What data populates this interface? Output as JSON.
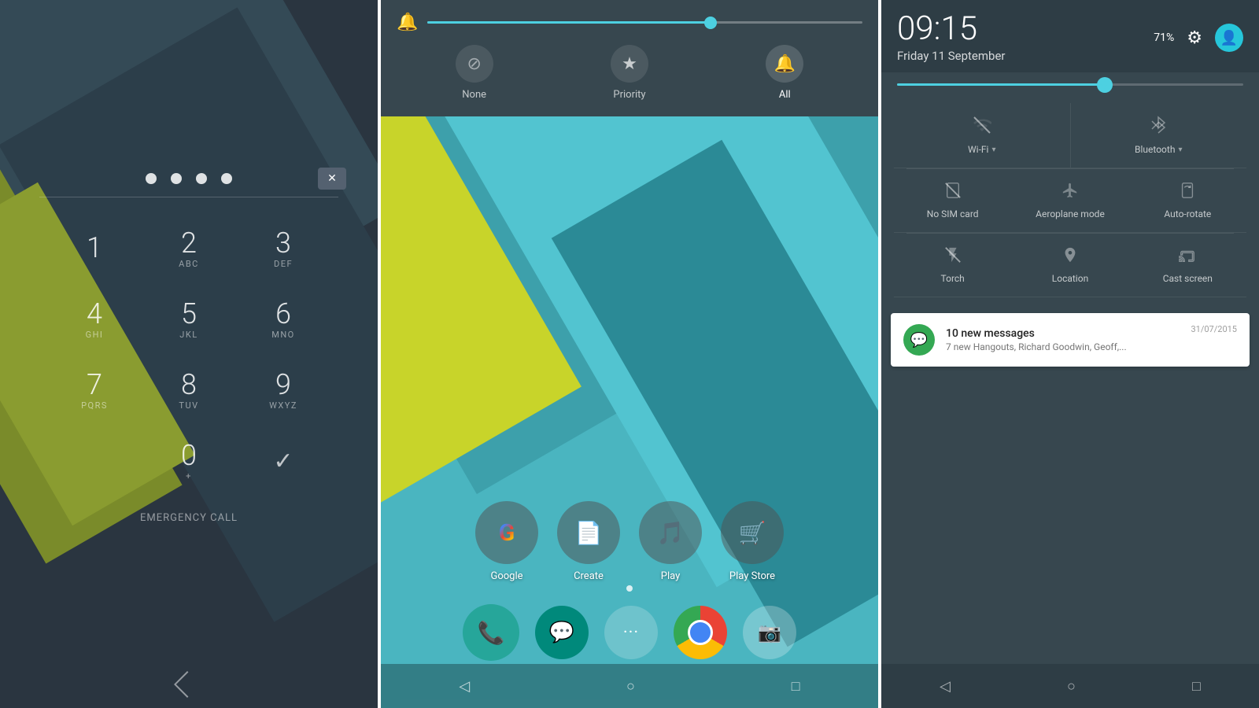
{
  "panel_pin": {
    "dots": [
      "dot1",
      "dot2",
      "dot3",
      "dot4"
    ],
    "keys": [
      {
        "num": "1",
        "letters": ""
      },
      {
        "num": "2",
        "letters": "ABC"
      },
      {
        "num": "3",
        "letters": "DEF"
      },
      {
        "num": "4",
        "letters": "GHI"
      },
      {
        "num": "5",
        "letters": "JKL"
      },
      {
        "num": "6",
        "letters": "MNO"
      },
      {
        "num": "7",
        "letters": "PQRS"
      },
      {
        "num": "8",
        "letters": "TUV"
      },
      {
        "num": "9",
        "letters": "WXYZ"
      },
      {
        "num": "0",
        "letters": "+"
      }
    ],
    "emergency_label": "EMERGENCY CALL"
  },
  "panel_home": {
    "notification_bar": {
      "slider_pct": 65,
      "options": [
        {
          "label": "None",
          "icon": "⊘",
          "active": false
        },
        {
          "label": "Priority",
          "icon": "★",
          "active": false
        },
        {
          "label": "All",
          "icon": "🔔",
          "active": true
        }
      ]
    },
    "apps": [
      {
        "label": "Google",
        "icon": "G"
      },
      {
        "label": "Create",
        "icon": "📄"
      },
      {
        "label": "Play",
        "icon": "🎵"
      },
      {
        "label": "Play Store",
        "icon": "▶"
      }
    ],
    "dock": [
      {
        "label": "Phone",
        "icon": "📞"
      },
      {
        "label": "Hangouts",
        "icon": "💬"
      },
      {
        "label": "Apps",
        "icon": "···"
      },
      {
        "label": "Chrome",
        "icon": "Chrome"
      },
      {
        "label": "Camera",
        "icon": "📷"
      }
    ],
    "nav": [
      "◁",
      "○",
      "□"
    ]
  },
  "panel_qs": {
    "header": {
      "time": "09:15",
      "date": "Friday 11 September",
      "battery": "71%"
    },
    "brightness_pct": 60,
    "toggles_row1": [
      {
        "label": "Wi-Fi",
        "has_arrow": true,
        "active": false,
        "icon": "wifi"
      },
      {
        "label": "Bluetooth",
        "has_arrow": true,
        "active": false,
        "icon": "bt"
      }
    ],
    "toggles_row2": [
      {
        "label": "No SIM card",
        "active": false,
        "icon": "nosim"
      },
      {
        "label": "Aeroplane mode",
        "active": false,
        "icon": "airplane"
      },
      {
        "label": "Auto-rotate",
        "active": false,
        "icon": "rotate"
      }
    ],
    "toggles_row3": [
      {
        "label": "Torch",
        "active": false,
        "icon": "torch"
      },
      {
        "label": "Location",
        "active": false,
        "icon": "location"
      },
      {
        "label": "Cast screen",
        "active": false,
        "icon": "cast"
      }
    ],
    "notification": {
      "title": "10 new messages",
      "body": "7 new Hangouts, Richard Goodwin, Geoff,...",
      "time": "31/07/2015",
      "icon": "💬"
    },
    "nav": [
      "◁",
      "○",
      "□"
    ]
  }
}
